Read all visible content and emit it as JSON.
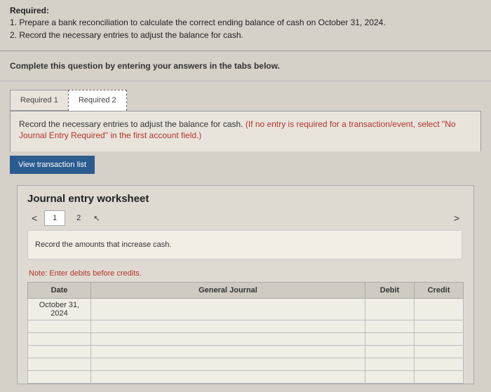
{
  "header": {
    "required_label": "Required:",
    "items": [
      "1. Prepare a bank reconciliation to calculate the correct ending balance of cash on October 31, 2024.",
      "2. Record the necessary entries to adjust the balance for cash."
    ]
  },
  "instruction": "Complete this question by entering your answers in the tabs below.",
  "tabs": {
    "items": [
      {
        "label": "Required 1"
      },
      {
        "label": "Required 2"
      }
    ]
  },
  "prompt": {
    "main": "Record the necessary entries to adjust the balance for cash. ",
    "hint": "(If no entry is required for a transaction/event, select \"No Journal Entry Required\" in the first account field.)"
  },
  "view_button": "View transaction list",
  "worksheet": {
    "title": "Journal entry worksheet",
    "nav": {
      "prev": "<",
      "next": ">",
      "pages": [
        "1",
        "2"
      ]
    },
    "sub_prompt": "Record the amounts that increase cash.",
    "note": "Note: Enter debits before credits.",
    "columns": {
      "date": "Date",
      "gj": "General Journal",
      "debit": "Debit",
      "credit": "Credit"
    },
    "first_date": "October 31, 2024"
  }
}
